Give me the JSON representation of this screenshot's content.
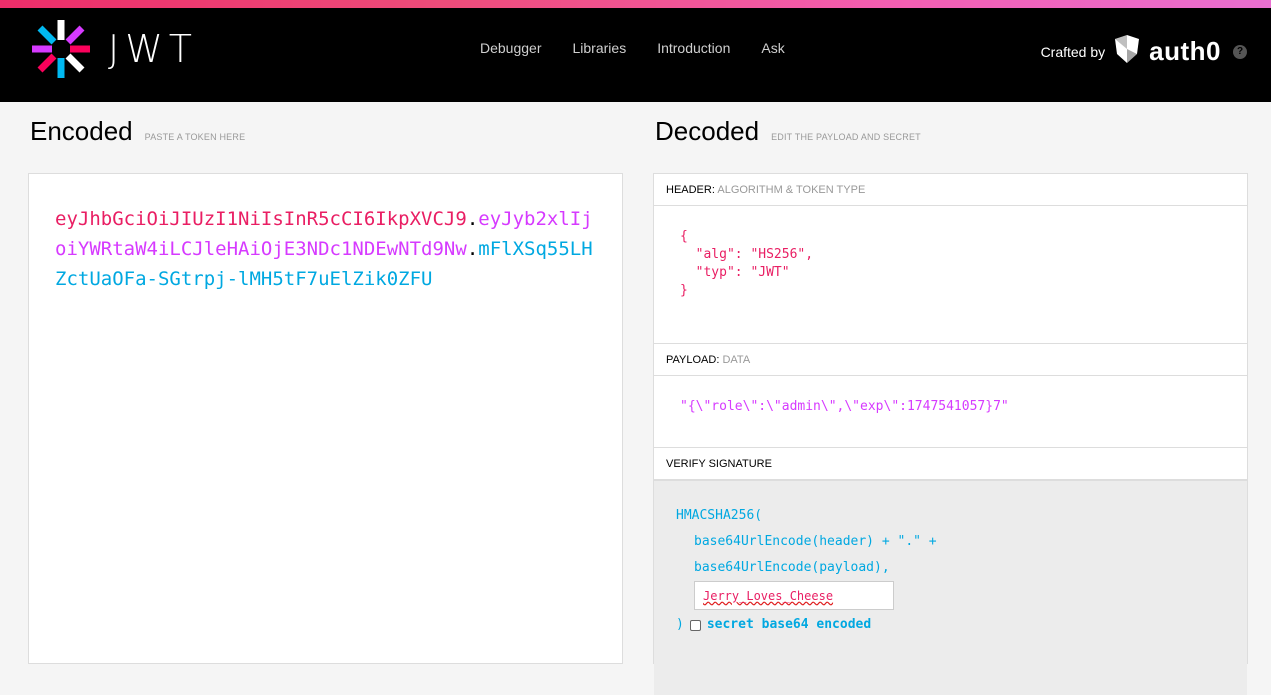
{
  "nav": {
    "logo_text": "JWT",
    "links": [
      "Debugger",
      "Libraries",
      "Introduction",
      "Ask"
    ],
    "crafted_by": "Crafted by",
    "brand": "auth0",
    "help_glyph": "?"
  },
  "encoded": {
    "title": "Encoded",
    "hint": "PASTE A TOKEN HERE",
    "token_header": "eyJhbGciOiJIUzI1NiIsInR5cCI6IkpXVCJ9",
    "token_payload": "eyJyb2xlIjoiYWRtaW4iLCJleHAiOjE3NDc1NDEwNTd9Nw",
    "token_signature": "mFlXSq55LHZctUaOFa-SGtrpj-lMH5tF7uElZik0ZFU",
    "dot": "."
  },
  "decoded": {
    "title": "Decoded",
    "hint": "EDIT THE PAYLOAD AND SECRET",
    "header_panel": {
      "label": "HEADER:",
      "sub": "ALGORITHM & TOKEN TYPE",
      "lines": [
        "{",
        "  \"alg\": \"HS256\",",
        "  \"typ\": \"JWT\"",
        "}"
      ]
    },
    "payload_panel": {
      "label": "PAYLOAD:",
      "sub": "DATA",
      "content": "\"{\\\"role\\\":\\\"admin\\\",\\\"exp\\\":1747541057}7\""
    },
    "signature_panel": {
      "label": "VERIFY SIGNATURE",
      "fn_open": "HMACSHA256(",
      "line1": "base64UrlEncode(header) + \".\" +",
      "line2": "base64UrlEncode(payload),",
      "secret_value": "Jerry_Loves_Cheese",
      "close_paren": ")",
      "checkbox_label": "secret base64 encoded"
    }
  },
  "colors": {
    "header": "#e91e63",
    "payload": "#d63aff",
    "signature": "#00a8e1"
  }
}
